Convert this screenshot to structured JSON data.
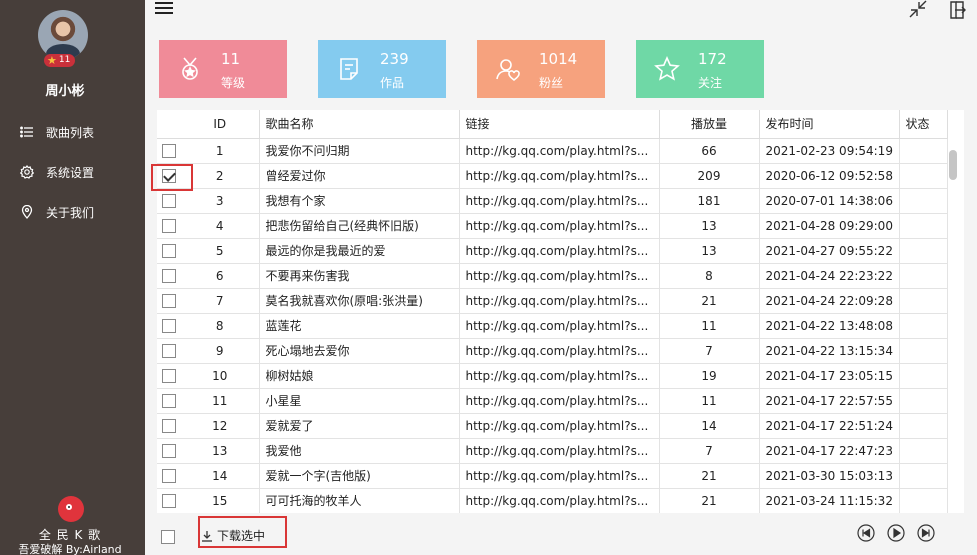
{
  "sidebar": {
    "level": "11",
    "username": "周小彬",
    "nav": [
      {
        "label": "歌曲列表",
        "icon": "list-icon"
      },
      {
        "label": "系统设置",
        "icon": "gear-icon"
      },
      {
        "label": "关于我们",
        "icon": "location-pin-icon"
      }
    ],
    "app_name": "全 民 K 歌",
    "credit": "吾爱破解 By:Airland"
  },
  "stats": [
    {
      "value": "11",
      "label": "等级",
      "color": "#f08b98",
      "icon": "medal-icon"
    },
    {
      "value": "239",
      "label": "作品",
      "color": "#84cbef",
      "icon": "document-icon"
    },
    {
      "value": "1014",
      "label": "粉丝",
      "color": "#f6a27e",
      "icon": "fan-icon"
    },
    {
      "value": "172",
      "label": "关注",
      "color": "#6fd8a6",
      "icon": "star-icon"
    }
  ],
  "table": {
    "headers": {
      "id": "ID",
      "name": "歌曲名称",
      "link": "链接",
      "plays": "播放量",
      "date": "发布时间",
      "status": "状态"
    },
    "rows": [
      {
        "id": "1",
        "name": "我爱你不问归期",
        "link": "http://kg.qq.com/play.html?s...",
        "plays": "66",
        "date": "2021-02-23 09:54:19",
        "checked": false
      },
      {
        "id": "2",
        "name": "曾经爱过你",
        "link": "http://kg.qq.com/play.html?s...",
        "plays": "209",
        "date": "2020-06-12 09:52:58",
        "checked": true
      },
      {
        "id": "3",
        "name": "我想有个家",
        "link": "http://kg.qq.com/play.html?s...",
        "plays": "181",
        "date": "2020-07-01 14:38:06",
        "checked": false
      },
      {
        "id": "4",
        "name": "把悲伤留给自己(经典怀旧版)",
        "link": "http://kg.qq.com/play.html?s...",
        "plays": "13",
        "date": "2021-04-28 09:29:00",
        "checked": false
      },
      {
        "id": "5",
        "name": "最远的你是我最近的爱",
        "link": "http://kg.qq.com/play.html?s...",
        "plays": "13",
        "date": "2021-04-27 09:55:22",
        "checked": false
      },
      {
        "id": "6",
        "name": "不要再来伤害我",
        "link": "http://kg.qq.com/play.html?s...",
        "plays": "8",
        "date": "2021-04-24 22:23:22",
        "checked": false
      },
      {
        "id": "7",
        "name": "莫名我就喜欢你(原唱:张洪量)",
        "link": "http://kg.qq.com/play.html?s...",
        "plays": "21",
        "date": "2021-04-24 22:09:28",
        "checked": false
      },
      {
        "id": "8",
        "name": "蓝莲花",
        "link": "http://kg.qq.com/play.html?s...",
        "plays": "11",
        "date": "2021-04-22 13:48:08",
        "checked": false
      },
      {
        "id": "9",
        "name": "死心塌地去爱你",
        "link": "http://kg.qq.com/play.html?s...",
        "plays": "7",
        "date": "2021-04-22 13:15:34",
        "checked": false
      },
      {
        "id": "10",
        "name": "柳树姑娘",
        "link": "http://kg.qq.com/play.html?s...",
        "plays": "19",
        "date": "2021-04-17 23:05:15",
        "checked": false
      },
      {
        "id": "11",
        "name": "小星星",
        "link": "http://kg.qq.com/play.html?s...",
        "plays": "11",
        "date": "2021-04-17 22:57:55",
        "checked": false
      },
      {
        "id": "12",
        "name": "爱就爱了",
        "link": "http://kg.qq.com/play.html?s...",
        "plays": "14",
        "date": "2021-04-17 22:51:24",
        "checked": false
      },
      {
        "id": "13",
        "name": "我爱他",
        "link": "http://kg.qq.com/play.html?s...",
        "plays": "7",
        "date": "2021-04-17 22:47:23",
        "checked": false
      },
      {
        "id": "14",
        "name": "爱就一个字(吉他版)",
        "link": "http://kg.qq.com/play.html?s...",
        "plays": "21",
        "date": "2021-03-30 15:03:13",
        "checked": false
      },
      {
        "id": "15",
        "name": "可可托海的牧羊人",
        "link": "http://kg.qq.com/play.html?s...",
        "plays": "21",
        "date": "2021-03-24 11:15:32",
        "checked": false
      }
    ]
  },
  "footer": {
    "download_label": "下载选中"
  }
}
